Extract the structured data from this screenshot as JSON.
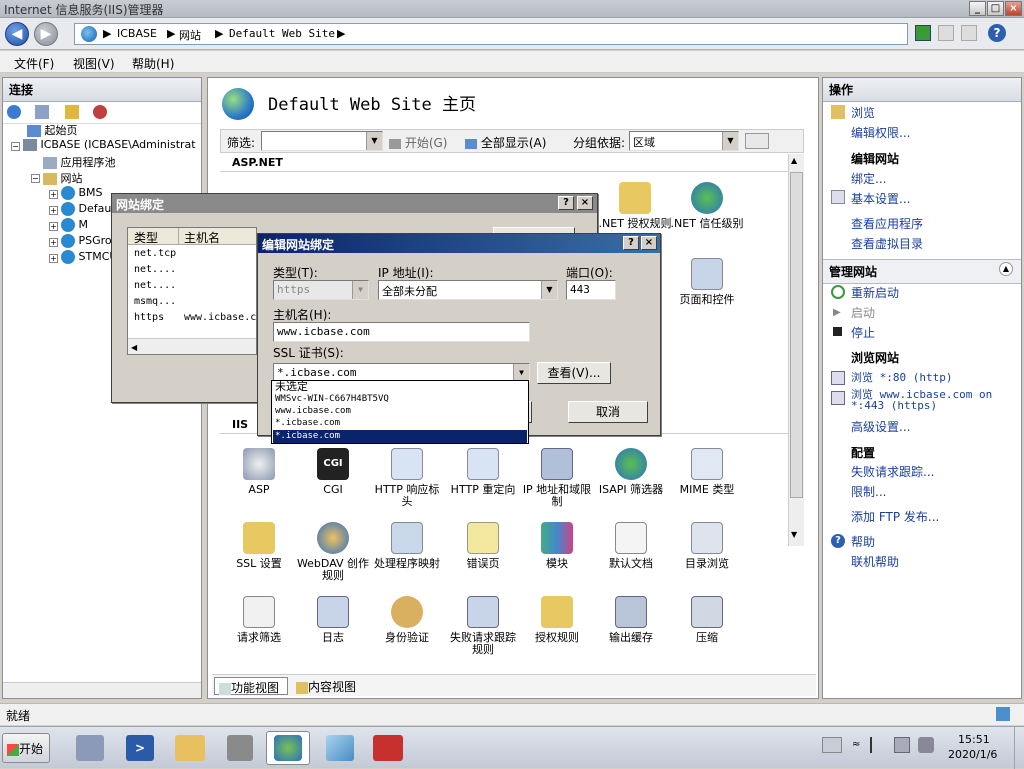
{
  "window": {
    "title": "Internet 信息服务(IIS)管理器"
  },
  "address": {
    "crumbs": [
      "ICBASE",
      "网站",
      "Default Web Site"
    ]
  },
  "menu": {
    "items": [
      "文件(F)",
      "视图(V)",
      "帮助(H)"
    ]
  },
  "left": {
    "header": "连接",
    "tree": [
      {
        "label": "起始页"
      },
      {
        "label": "ICBASE (ICBASE\\Administrat"
      },
      {
        "label": "应用程序池"
      },
      {
        "label": "网站"
      },
      {
        "label": "BMS"
      },
      {
        "label": "Defau"
      },
      {
        "label": "M"
      },
      {
        "label": "PSGro"
      },
      {
        "label": "STMCU"
      }
    ]
  },
  "center": {
    "title": "Default Web Site 主页",
    "filter_label": "筛选:",
    "start_label": "开始(G)",
    "showall_label": "全部显示(A)",
    "groupby_label": "分组依据:",
    "groupby_value": "区域",
    "section_aspnet": "ASP.NET",
    "section_iis": "IIS",
    "aspnet_items": [
      ".NET 授权规则",
      ".NET 信任级别",
      "页面和控件"
    ],
    "iis_items": [
      "ASP",
      "CGI",
      "HTTP 响应标头",
      "HTTP 重定向",
      "IP 地址和域限制",
      "ISAPI 筛选器",
      "MIME 类型",
      "SSL 设置",
      "WebDAV 创作规则",
      "处理程序映射",
      "错误页",
      "模块",
      "默认文档",
      "目录浏览",
      "请求筛选",
      "日志",
      "身份验证",
      "失败请求跟踪规则",
      "授权规则",
      "输出缓存",
      "压缩"
    ],
    "cgi_text": "CGI",
    "tab_features": "功能视图",
    "tab_content": "内容视图"
  },
  "right": {
    "header": "操作",
    "group1": [
      "浏览",
      "编辑权限..."
    ],
    "edit_site_hdr": "编辑网站",
    "group2": [
      "绑定...",
      "基本设置..."
    ],
    "group3": [
      "查看应用程序",
      "查看虚拟目录"
    ],
    "manage_hdr": "管理网站",
    "manage": [
      "重新启动",
      "启动",
      "停止"
    ],
    "browse_hdr": "浏览网站",
    "browse": [
      "浏览 *:80 (http)",
      "浏览 www.icbase.com on",
      "*:443 (https)"
    ],
    "advanced": "高级设置...",
    "config_hdr": "配置",
    "config": [
      "失败请求跟踪...",
      "限制..."
    ],
    "ftp": "添加 FTP 发布...",
    "help": [
      "帮助",
      "联机帮助"
    ]
  },
  "bindings_dialog": {
    "title": "网站绑定",
    "col_type": "类型",
    "col_host": "主机名",
    "rows": [
      {
        "type": "net.tcp",
        "host": ""
      },
      {
        "type": "net....",
        "host": ""
      },
      {
        "type": "net....",
        "host": ""
      },
      {
        "type": "msmq...",
        "host": ""
      },
      {
        "type": "https",
        "host": "www.icbase.c"
      }
    ]
  },
  "edit_dialog": {
    "title": "编辑网站绑定",
    "type_label": "类型(T):",
    "type_value": "https",
    "ip_label": "IP 地址(I):",
    "ip_value": "全部未分配",
    "port_label": "端口(O):",
    "port_value": "443",
    "host_label": "主机名(H):",
    "host_value": "www.icbase.com",
    "ssl_label": "SSL 证书(S):",
    "ssl_value": "*.icbase.com",
    "view_button": "查看(V)...",
    "cancel_button": "取消",
    "ssl_options": [
      "未选定",
      "WMSvc-WIN-C667H4BT5VQ",
      "www.icbase.com",
      "*.icbase.com",
      "*.icbase.com"
    ],
    "ssl_selected_index": 4
  },
  "status": {
    "text": "就绪"
  },
  "taskbar": {
    "start": "开始",
    "time": "15:51",
    "date": "2020/1/6"
  }
}
